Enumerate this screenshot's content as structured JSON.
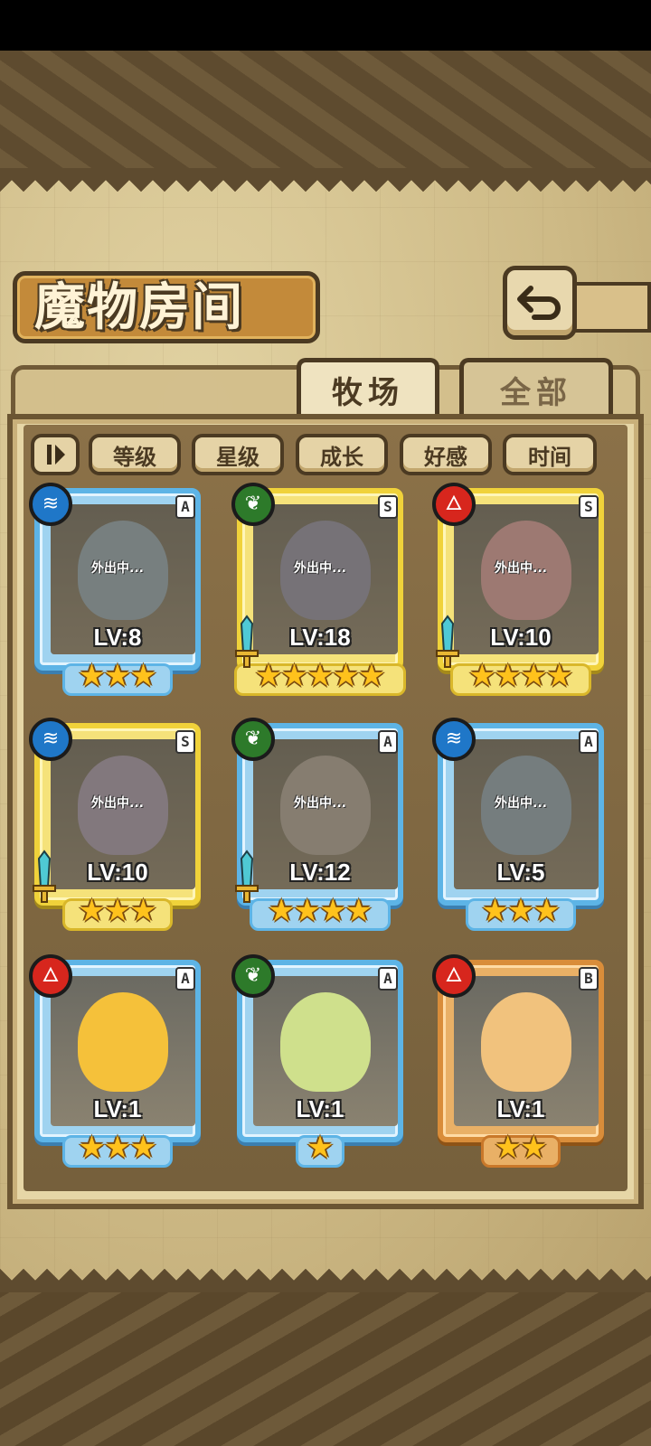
{
  "title": "魔物房间",
  "tabs": [
    {
      "label": "牧场",
      "active": true
    },
    {
      "label": "全部",
      "active": false
    }
  ],
  "sort": {
    "toggle_icon": "sort-order-icon",
    "buttons": [
      "等级",
      "星级",
      "成长",
      "好感",
      "时间"
    ]
  },
  "away_text": "外出中...",
  "monsters": [
    {
      "element": "water",
      "rank": "A",
      "level": "LV:8",
      "stars": 3,
      "frame": "blue",
      "away": true,
      "weapon": false,
      "tint": "#8fa7b7"
    },
    {
      "element": "leaf",
      "rank": "S",
      "level": "LV:18",
      "stars": 5,
      "frame": "gold",
      "away": true,
      "weapon": true,
      "tint": "#8c8fa8"
    },
    {
      "element": "fire",
      "rank": "S",
      "level": "LV:10",
      "stars": 4,
      "frame": "gold",
      "away": true,
      "weapon": true,
      "tint": "#d49c9f"
    },
    {
      "element": "water",
      "rank": "S",
      "level": "LV:10",
      "stars": 3,
      "frame": "gold",
      "away": true,
      "weapon": true,
      "tint": "#a39ab3"
    },
    {
      "element": "leaf",
      "rank": "A",
      "level": "LV:12",
      "stars": 4,
      "frame": "blue",
      "away": true,
      "weapon": true,
      "tint": "#a9a39c"
    },
    {
      "element": "water",
      "rank": "A",
      "level": "LV:5",
      "stars": 3,
      "frame": "blue",
      "away": true,
      "weapon": false,
      "tint": "#8aa2b4"
    },
    {
      "element": "fire",
      "rank": "A",
      "level": "LV:1",
      "stars": 3,
      "frame": "blue",
      "away": false,
      "weapon": false,
      "tint": "#f5c13a"
    },
    {
      "element": "leaf",
      "rank": "A",
      "level": "LV:1",
      "stars": 1,
      "frame": "blue",
      "away": false,
      "weapon": false,
      "tint": "#cfe08c"
    },
    {
      "element": "fire",
      "rank": "B",
      "level": "LV:1",
      "stars": 2,
      "frame": "bronze",
      "away": false,
      "weapon": false,
      "tint": "#f1c27d"
    }
  ],
  "colors": {
    "water": "#1f77c8",
    "fire": "#d7261d",
    "leaf": "#2d7a2a"
  }
}
